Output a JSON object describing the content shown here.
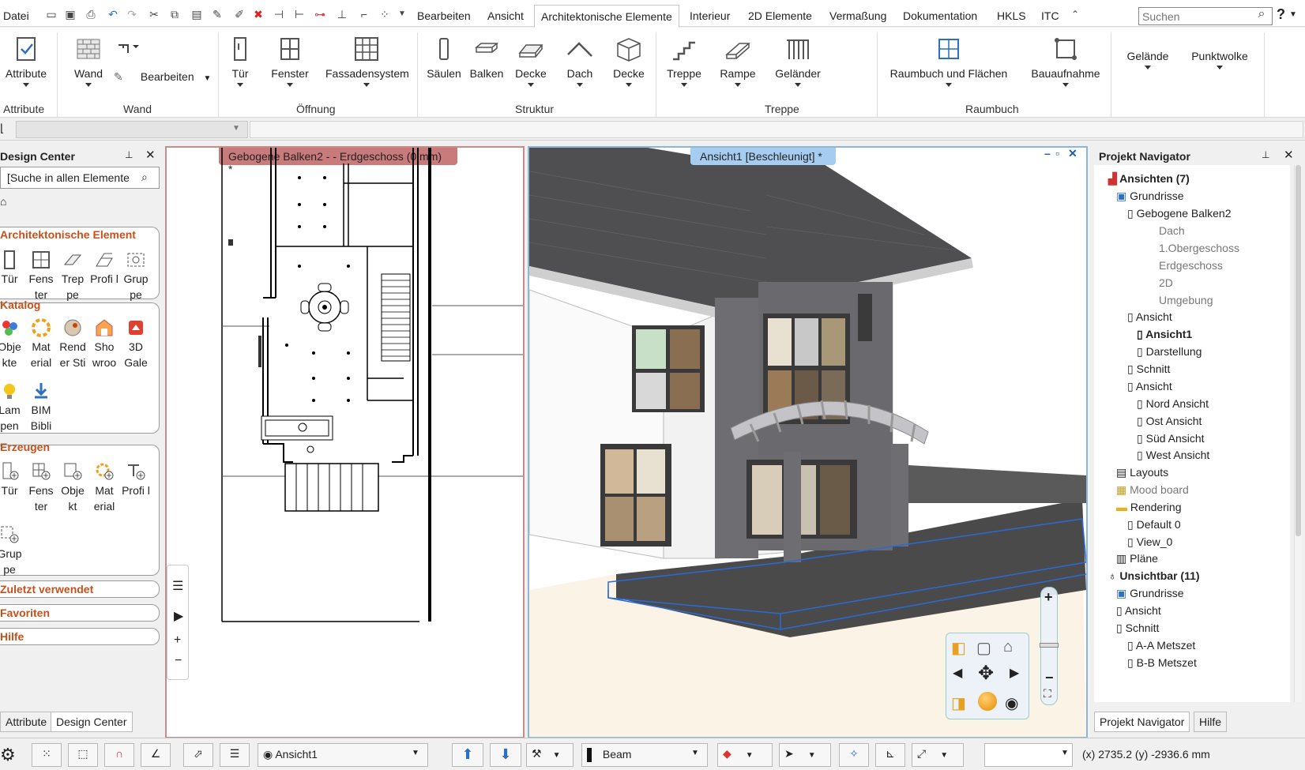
{
  "menu": {
    "file": "Datei",
    "items": [
      "Bearbeiten",
      "Ansicht",
      "Architektonische Elemente",
      "Interieur",
      "2D Elemente",
      "Vermaßung",
      "Dokumentation",
      "HKLS",
      "ITC"
    ],
    "active_index": 2,
    "search_placeholder": "Suchen",
    "help": "?"
  },
  "ribbon": {
    "attribute": {
      "label": "Attribute",
      "group": "Attribute"
    },
    "wand": {
      "label": "Wand",
      "edit": "Bearbeiten",
      "group": "Wand"
    },
    "oeffnung": {
      "items": [
        "Tür",
        "Fenster",
        "Fassadensystem"
      ],
      "group": "Öffnung"
    },
    "struktur": {
      "items": [
        "Säulen",
        "Balken",
        "Decke",
        "Dach",
        "Decke"
      ],
      "group": "Struktur"
    },
    "treppe": {
      "items": [
        "Treppe",
        "Rampe",
        "Geländer"
      ],
      "group": "Treppe"
    },
    "raumbuch": {
      "items": [
        "Raumbuch und Flächen",
        "Bauaufnahme"
      ],
      "group": "Raumbuch"
    },
    "extra": [
      "Gelände",
      "Punktwolke"
    ]
  },
  "design_center": {
    "title": "Design Center",
    "search": "[Suche in allen Elemente",
    "sections": {
      "arch": {
        "title": "Architektonische Element",
        "items": [
          "Tür",
          "Fens ter",
          "Trep pe",
          "Profi l",
          "Grup pe"
        ]
      },
      "katalog": {
        "title": "Katalog",
        "items": [
          "Obje kte",
          "Mat erial",
          "Rend er Sti",
          "Sho wroo",
          "3D Gale",
          "Lam pen",
          "BIM Bibli"
        ]
      },
      "erzeugen": {
        "title": "Erzeugen",
        "items": [
          "Tür",
          "Fens ter",
          "Obje kt",
          "Mat erial",
          "Profi l",
          "Grup pe"
        ]
      },
      "zuletzt": "Zuletzt verwendet",
      "favoriten": "Favoriten",
      "hilfe": "Hilfe"
    },
    "tabs": [
      "Attribute",
      "Design Center"
    ]
  },
  "viewports": {
    "plan_title": "Gebogene Balken2 -  - Erdgeschoss (0 mm) *",
    "view3d_title": "Ansicht1 [Beschleunigt] *"
  },
  "navigator": {
    "title": "Projekt Navigator",
    "nodes": [
      {
        "label": "Ansichten (7)",
        "bold": true
      },
      {
        "label": "Grundrisse"
      },
      {
        "label": "Gebogene Balken2"
      },
      {
        "label": "Dach",
        "gray": true
      },
      {
        "label": "1.Obergeschoss",
        "gray": true
      },
      {
        "label": "Erdgeschoss",
        "gray": true
      },
      {
        "label": "2D",
        "gray": true
      },
      {
        "label": "Umgebung",
        "gray": true
      },
      {
        "label": "Ansicht"
      },
      {
        "label": "Ansicht1",
        "bold": true
      },
      {
        "label": "Darstellung"
      },
      {
        "label": "Schnitt"
      },
      {
        "label": "Ansicht"
      },
      {
        "label": "Nord Ansicht"
      },
      {
        "label": "Ost Ansicht"
      },
      {
        "label": "Süd Ansicht"
      },
      {
        "label": "West Ansicht"
      },
      {
        "label": "Layouts"
      },
      {
        "label": "Mood board",
        "gray": true
      },
      {
        "label": "Rendering"
      },
      {
        "label": "Default 0"
      },
      {
        "label": "View_0"
      },
      {
        "label": "Pläne"
      },
      {
        "label": "Unsichtbar (11)",
        "bold": true
      },
      {
        "label": "Grundrisse"
      },
      {
        "label": "Ansicht"
      },
      {
        "label": "Schnitt"
      },
      {
        "label": "A-A Metszet"
      },
      {
        "label": "B-B Metszet"
      }
    ],
    "tabs": [
      "Projekt Navigator",
      "Hilfe"
    ]
  },
  "statusbar": {
    "view_select": "Ansicht1",
    "element_type": "Beam",
    "coords": "(x) 2735.2  (y) -2936.6 mm"
  }
}
